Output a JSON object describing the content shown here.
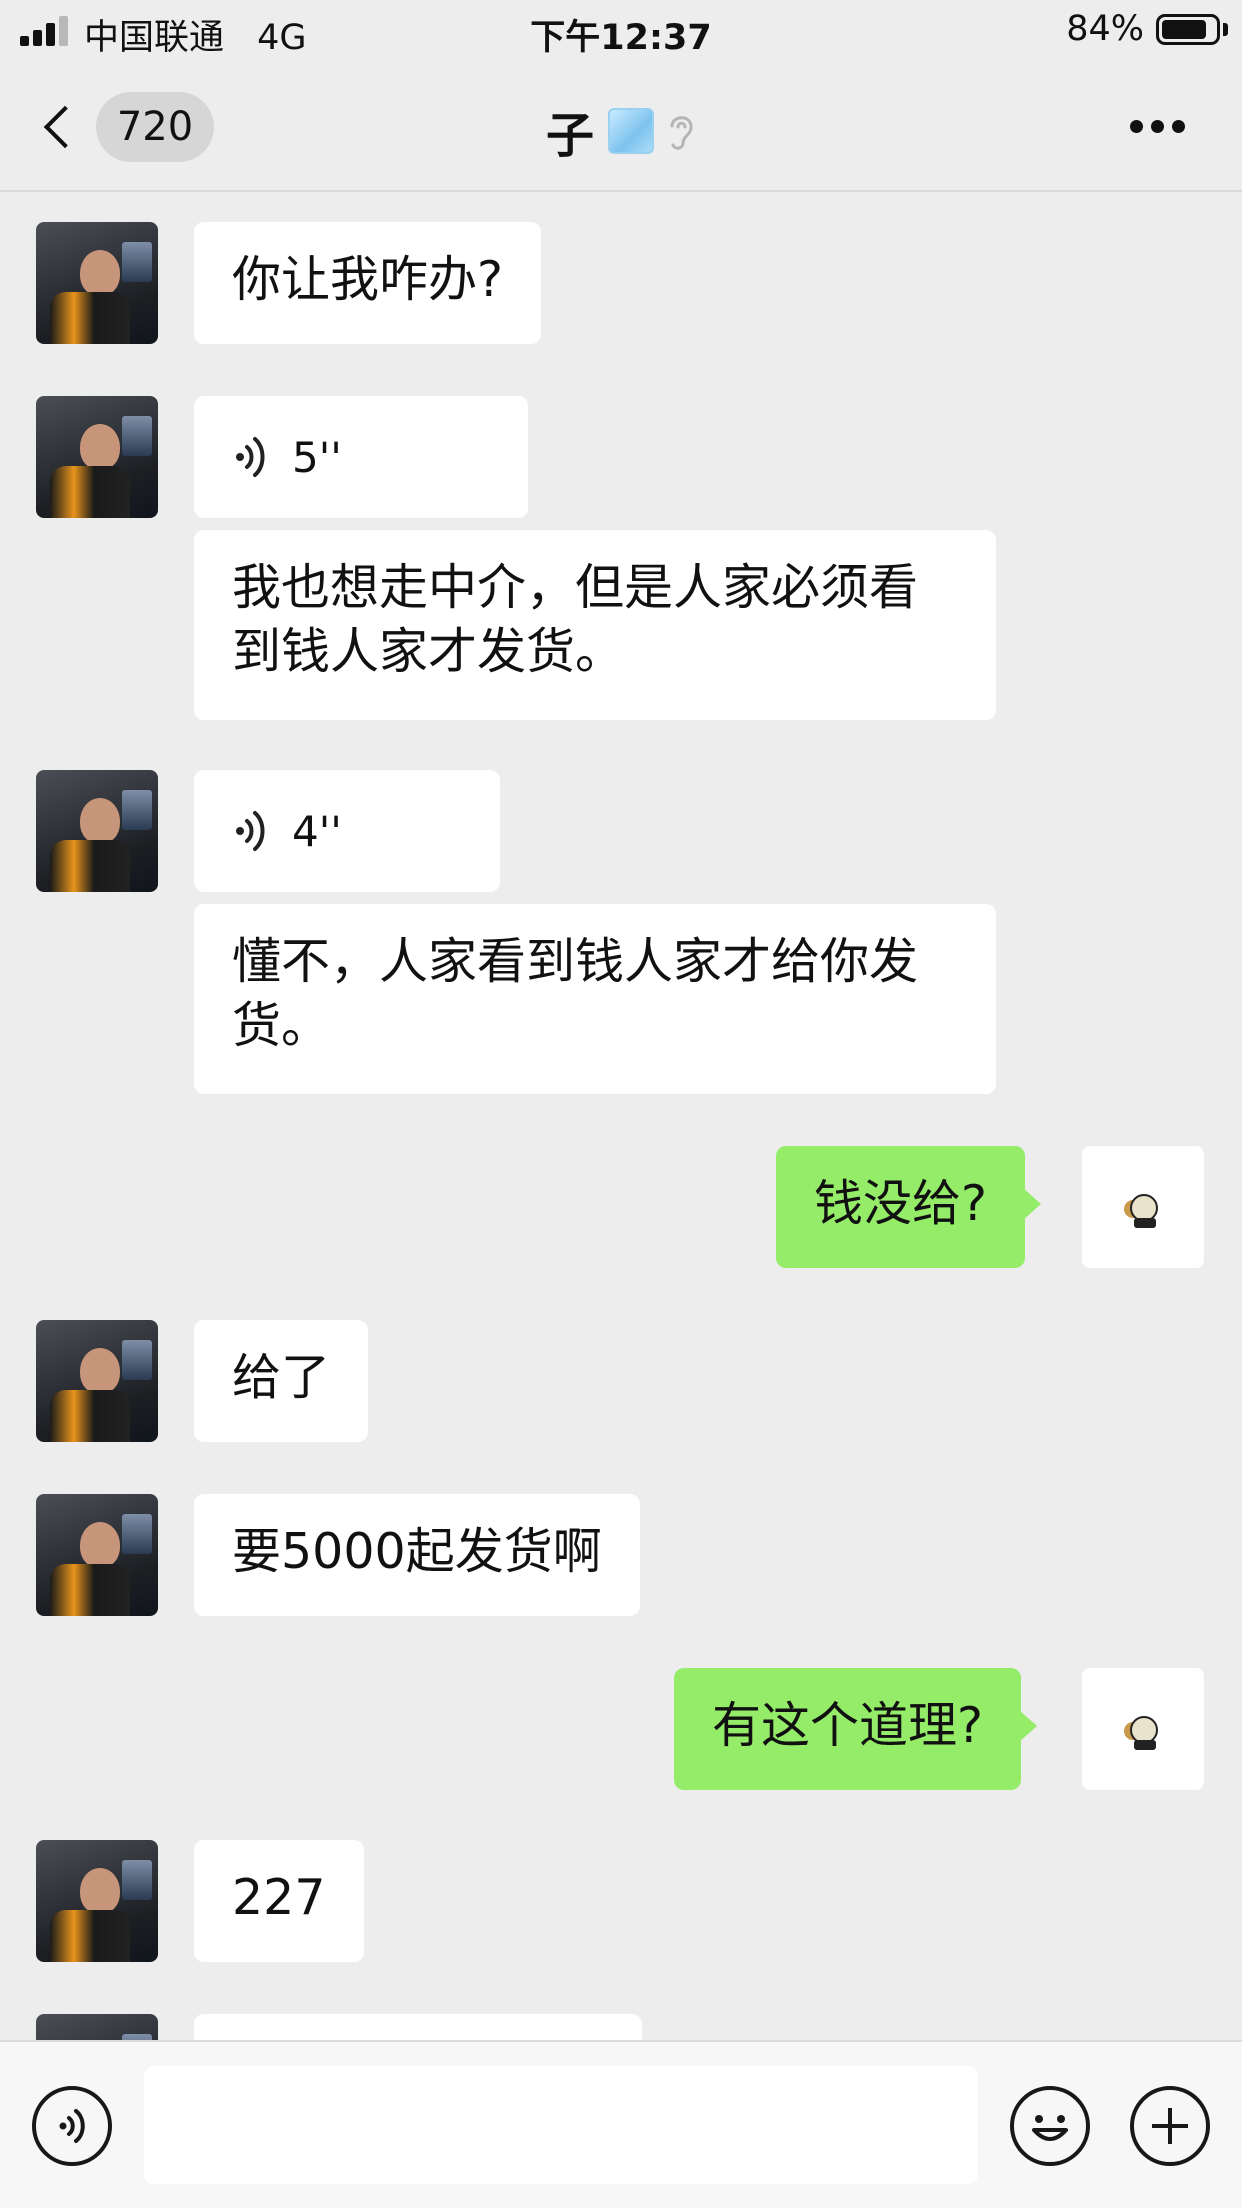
{
  "status_bar": {
    "carrier": "中国联通",
    "network": "4G",
    "time": "下午12:37",
    "battery_percent": "84%",
    "battery_level": 0.84,
    "signal_bars": 3
  },
  "nav": {
    "unread_count": "720",
    "title": "子",
    "title_icons": [
      "ice-cube-icon",
      "ear-icon"
    ],
    "more_icon": "more-dots-icon"
  },
  "messages": [
    {
      "side": "left",
      "type": "text",
      "text": "你让我咋办?"
    },
    {
      "side": "left",
      "type": "voice",
      "duration": "5''"
    },
    {
      "side": "left",
      "type": "text",
      "text": "我也想走中介，但是人家必须看到钱人家才发货。"
    },
    {
      "side": "left",
      "type": "voice",
      "duration": "4''"
    },
    {
      "side": "left",
      "type": "text",
      "text": "懂不，人家看到钱人家才给你发货。"
    },
    {
      "side": "right",
      "type": "text",
      "text": "钱没给?"
    },
    {
      "side": "left",
      "type": "text",
      "text": "给了"
    },
    {
      "side": "left",
      "type": "text",
      "text": "要5000起发货啊"
    },
    {
      "side": "right",
      "type": "text",
      "text": "有这个道理?"
    },
    {
      "side": "left",
      "type": "text",
      "text": "227"
    }
  ],
  "input_bar": {
    "voice_icon": "voice-input-icon",
    "emoji_icon": "emoji-icon",
    "plus_icon": "plus-icon",
    "placeholder": ""
  },
  "colors": {
    "background": "#ededed",
    "my_bubble": "#95ec69",
    "their_bubble": "#ffffff"
  }
}
